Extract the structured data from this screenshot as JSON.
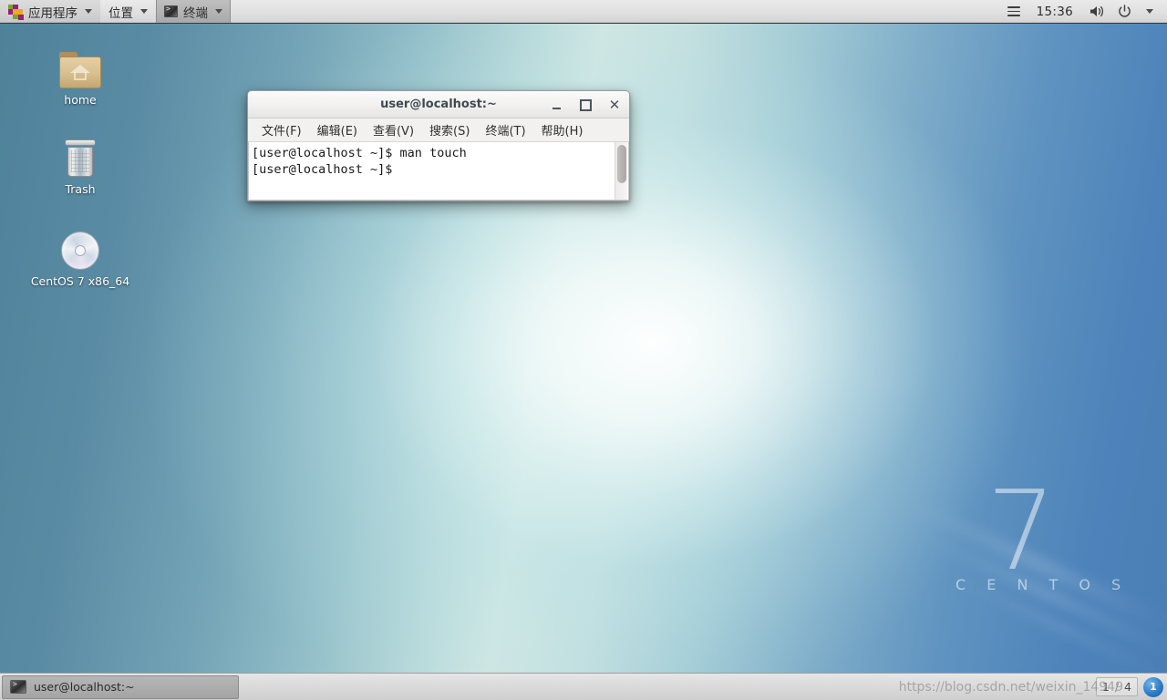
{
  "top_panel": {
    "applications_menu": {
      "label": "应用程序",
      "icon": "centos-logo-icon"
    },
    "places_menu": {
      "label": "位置"
    },
    "active_window": {
      "label": "终端",
      "icon": "terminal-icon"
    },
    "hamburger_icon": "hamburger-menu-icon",
    "clock": "15:36",
    "volume_icon": "volume-icon",
    "power_icon": "power-icon",
    "system_caret": "chevron-down-icon"
  },
  "desktop": {
    "icons": [
      {
        "label": "home",
        "icon": "home-folder-icon"
      },
      {
        "label": "Trash",
        "icon": "trash-icon"
      },
      {
        "label": "CentOS 7 x86_64",
        "icon": "optical-disc-icon"
      }
    ],
    "wallpaper_logo": {
      "version": "7",
      "brand": "C E N T O S"
    },
    "colors": {
      "wallpaper_left": "#4e8299",
      "wallpaper_center": "#cfe6e3",
      "wallpaper_right": "#4a7eb5"
    }
  },
  "terminal_window": {
    "title": "user@localhost:~",
    "controls": {
      "minimize": "–",
      "maximize": "□",
      "close": "✕"
    },
    "menu": [
      {
        "label": "文件(F)"
      },
      {
        "label": "编辑(E)"
      },
      {
        "label": "查看(V)"
      },
      {
        "label": "搜索(S)"
      },
      {
        "label": "终端(T)"
      },
      {
        "label": "帮助(H)"
      }
    ],
    "content": "[user@localhost ~]$ man touch\n[user@localhost ~]$ "
  },
  "taskbar": {
    "window_button": {
      "label": "user@localhost:~",
      "icon": "terminal-icon"
    },
    "workspace_switcher": {
      "current": "1",
      "separator": "/",
      "total": "4"
    },
    "notification_badge": "1"
  },
  "watermark": "https://blog.csdn.net/weixin_14949"
}
